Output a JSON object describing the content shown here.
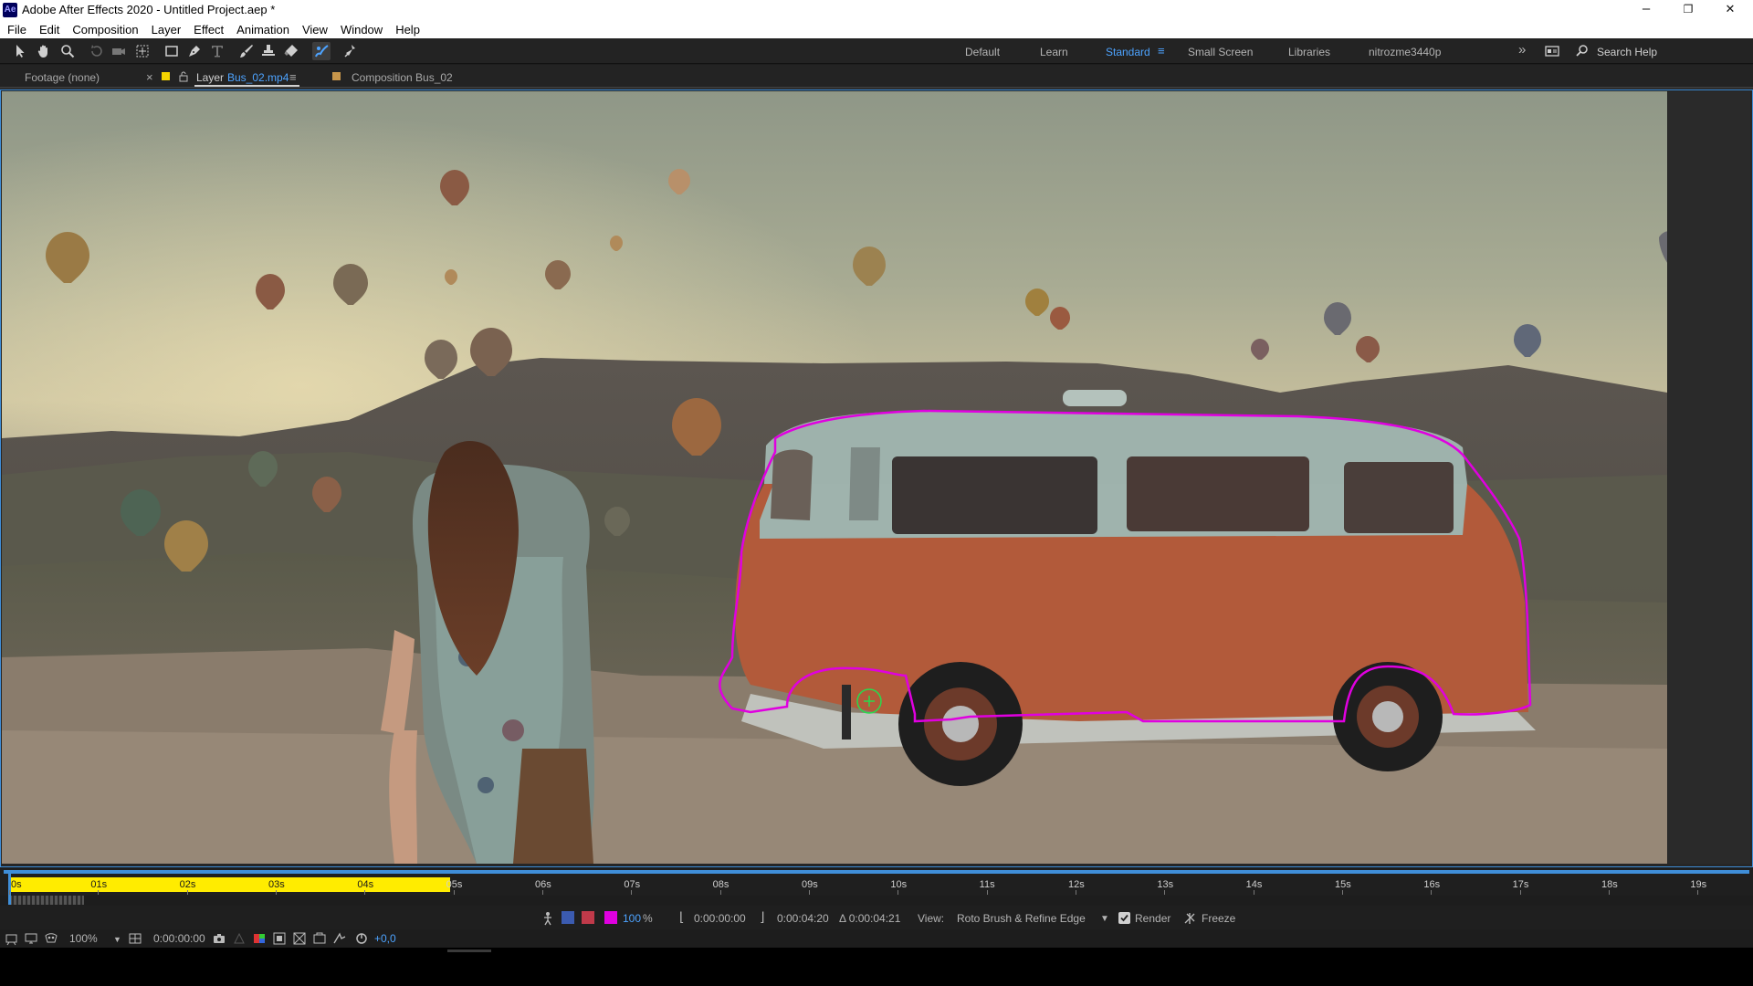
{
  "window": {
    "title": "Adobe After Effects 2020 - Untitled Project.aep *",
    "logo": "Ae",
    "minimize_glyph": "–",
    "restore_glyph": "❐",
    "close_glyph": "✕"
  },
  "menu": [
    "File",
    "Edit",
    "Composition",
    "Layer",
    "Effect",
    "Animation",
    "View",
    "Window",
    "Help"
  ],
  "toolbar": {
    "tools": [
      "selection-tool-icon",
      "hand-tool-icon",
      "zoom-tool-icon",
      "rotate-tool-icon",
      "camera-tool-icon",
      "pan-behind-tool-icon",
      "rectangle-tool-icon",
      "pen-tool-icon",
      "type-tool-icon",
      "brush-tool-icon",
      "clone-stamp-tool-icon",
      "eraser-tool-icon",
      "roto-brush-tool-icon",
      "puppet-tool-icon"
    ],
    "workspaces": [
      "Default",
      "Learn",
      "Standard",
      "Small Screen",
      "Libraries",
      "nitrozme3440p"
    ],
    "active_workspace": "Standard",
    "workspace_menu_glyph": "≡",
    "overflow_glyph": "»",
    "search_placeholder": "Search Help"
  },
  "tabs": {
    "footage": "Footage (none)",
    "close_glyph": "×",
    "layer_prefix": "Layer",
    "layer_name": "Bus_02.mp4",
    "menu_glyph": "≡",
    "composition": "Composition Bus_02"
  },
  "timeline": {
    "labels": [
      "0s",
      "01s",
      "02s",
      "03s",
      "04s",
      "05s",
      "06s",
      "07s",
      "08s",
      "09s",
      "10s",
      "11s",
      "12s",
      "13s",
      "14s",
      "15s",
      "16s",
      "17s",
      "18s",
      "19s"
    ],
    "propagated_until_seconds": 5.0,
    "total_seconds": 19.5
  },
  "roto": {
    "opacity": "100",
    "percent": "%",
    "in_time": "0:00:00:00",
    "out_time": "0:00:04:20",
    "duration": "Δ 0:00:04:21",
    "view_label": "View:",
    "view_value": "Roto Brush & Refine Edge",
    "render_label": "Render",
    "freeze_label": "Freeze"
  },
  "viewer_bar": {
    "zoom": "100%",
    "timecode": "0:00:00:00",
    "exposure": "+0,0"
  },
  "colors": {
    "accent": "#3f8ed8",
    "work_area": "#ffec00",
    "roto_outline": "#e000e0",
    "label_yellow": "#f5d400",
    "label_tan": "#c8964b"
  }
}
